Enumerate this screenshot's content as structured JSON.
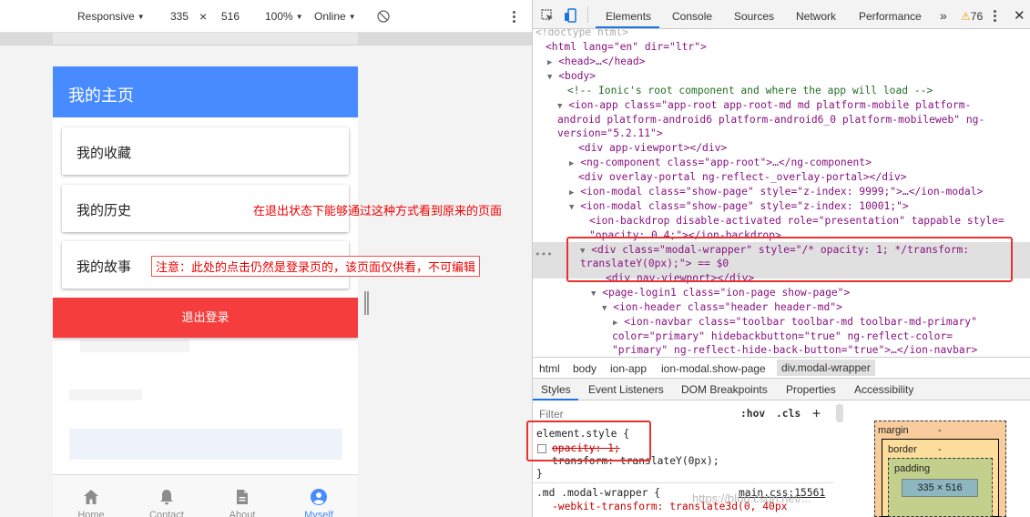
{
  "device_toolbar": {
    "mode": "Responsive",
    "width": "335",
    "times": "×",
    "height": "516",
    "zoom": "100%",
    "network": "Online"
  },
  "phone": {
    "title": "我的主页",
    "cards": [
      "我的收藏",
      "我的历史",
      "我的故事"
    ],
    "logout": "退出登录",
    "tabs": [
      {
        "label": "Home",
        "icon": "home-icon"
      },
      {
        "label": "Contact",
        "icon": "bell-icon"
      },
      {
        "label": "About",
        "icon": "document-icon"
      },
      {
        "label": "Myself",
        "icon": "account-icon"
      }
    ]
  },
  "annotations": {
    "note1": "在退出状态下能够通过这种方式看到原来的页面",
    "note2": "注意：此处的点击仍然是登录页的，该页面仅供看，不可编辑"
  },
  "devtools": {
    "tabs": [
      "Elements",
      "Console",
      "Sources",
      "Network",
      "Performance"
    ],
    "more": "»",
    "warning_count": "76",
    "dom_lines": [
      {
        "t": "<!doctype html>"
      },
      {
        "t": "<html lang=\"en\" dir=\"ltr\">"
      },
      {
        "t": "<head>…</head>"
      },
      {
        "t": "<body>"
      },
      {
        "t": "<!-- Ionic's root component and where the app will load -->"
      },
      {
        "t": "<ion-app class=\"app-root app-root-md md platform-mobile platform-"
      },
      {
        "t": "android platform-android6 platform-android6_0 platform-mobileweb\" ng-"
      },
      {
        "t": "version=\"5.2.11\">"
      },
      {
        "t": "<div app-viewport></div>"
      },
      {
        "t": "<ng-component class=\"app-root\">…</ng-component>"
      },
      {
        "t": "<div overlay-portal ng-reflect-_overlay-portal></div>"
      },
      {
        "t": "<ion-modal class=\"show-page\" style=\"z-index: 9999;\">…</ion-modal>"
      },
      {
        "t": "<ion-modal class=\"show-page\" style=\"z-index: 10001;\">"
      },
      {
        "t": "<ion-backdrop disable-activated role=\"presentation\" tappable style="
      },
      {
        "t": "\"opacity: 0.4;\"></ion-backdrop>"
      },
      {
        "t": "<div class=\"modal-wrapper\" style=\"/* opacity: 1; */transform:"
      },
      {
        "t": "translateY(0px);\"> == $0"
      },
      {
        "t": "<div nav-viewport></div>"
      },
      {
        "t": "<page-login1 class=\"ion-page show-page\">"
      },
      {
        "t": "<ion-header class=\"header header-md\">"
      },
      {
        "t": "<ion-navbar class=\"toolbar toolbar-md toolbar-md-primary\""
      },
      {
        "t": "color=\"primary\" hidebackbutton=\"true\" ng-reflect-color="
      },
      {
        "t": "\"primary\" ng-reflect-hide-back-button=\"true\">…</ion-navbar>"
      }
    ],
    "breadcrumbs": [
      "html",
      "body",
      "ion-app",
      "ion-modal.show-page",
      "div.modal-wrapper"
    ],
    "subtabs": [
      "Styles",
      "Event Listeners",
      "DOM Breakpoints",
      "Properties",
      "Accessibility"
    ],
    "filter_placeholder": "Filter",
    "hov": ":hov",
    "cls": ".cls",
    "plus": "+",
    "styles": {
      "element_style": "element.style {",
      "opacity": "opacity: 1;",
      "transform": "transform: translateY(0px);",
      "close": "}",
      "rule_selector": ".md .modal-wrapper {",
      "rule_source": "main.css:15561",
      "rule_prop": "-webkit-transform: translate3d(0, 40px"
    },
    "box_model": {
      "margin": "margin",
      "border": "border",
      "padding": "padding",
      "dash": "-",
      "content": "335 × 516"
    }
  },
  "watermark": "https://blog.csdn.net/..."
}
